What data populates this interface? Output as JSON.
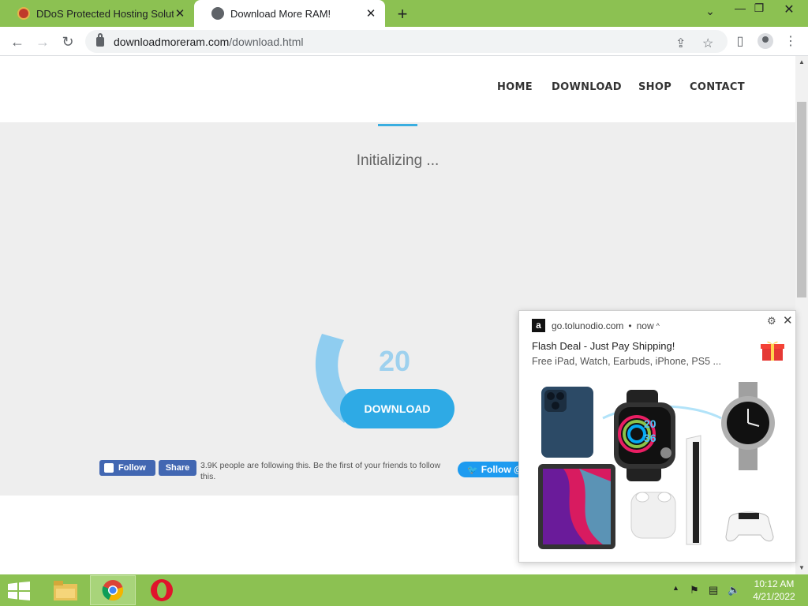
{
  "browser": {
    "tabs": [
      {
        "title": "DDoS Protected Hosting Solutio",
        "active": false
      },
      {
        "title": "Download More RAM!",
        "active": true
      }
    ],
    "new_tab": "+",
    "url_host": "downloadmoreram.com",
    "url_path": "/download.html"
  },
  "site": {
    "nav": [
      "HOME",
      "DOWNLOAD",
      "SHOP",
      "CONTACT"
    ],
    "status_text": "Initializing ...",
    "counter": "20",
    "download_button": "DOWNLOAD",
    "fb_follow": "Follow",
    "fb_share": "Share",
    "fb_text": "3.9K people are following this. Be the first of your friends to follow this.",
    "twitter_follow": "Follow @"
  },
  "notification": {
    "site": "go.tolunodio.com",
    "separator": "•",
    "time": "now",
    "title": "Flash Deal - Just Pay Shipping!",
    "body": "Free iPad, Watch, Earbuds, iPhone, PS5 ...",
    "watch_digits": [
      "20",
      "36"
    ]
  },
  "taskbar": {
    "time": "10:12 AM",
    "date": "4/21/2022"
  },
  "colors": {
    "tab_strip": "#8cc152",
    "accent": "#2eaae5",
    "hero_bg": "#eeeeee"
  }
}
